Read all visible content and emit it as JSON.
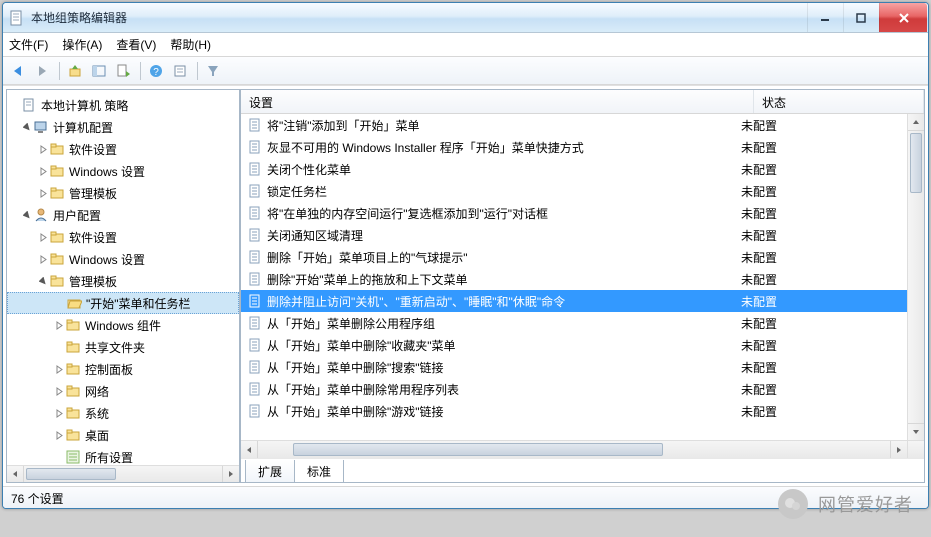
{
  "window": {
    "title": "本地组策略编辑器"
  },
  "menu": {
    "file": "文件(F)",
    "action": "操作(A)",
    "view": "查看(V)",
    "help": "帮助(H)"
  },
  "tree": {
    "root": "本地计算机 策略",
    "computer": {
      "label": "计算机配置",
      "software": "软件设置",
      "windows": "Windows 设置",
      "templates": "管理模板"
    },
    "user": {
      "label": "用户配置",
      "software": "软件设置",
      "windows": "Windows 设置",
      "templates": {
        "label": "管理模板",
        "startmenu": "\"开始\"菜单和任务栏",
        "wincomp": "Windows 组件",
        "shared": "共享文件夹",
        "ctrl": "控制面板",
        "network": "网络",
        "system": "系统",
        "desktop": "桌面",
        "all": "所有设置"
      }
    }
  },
  "list": {
    "header": {
      "setting": "设置",
      "state": "状态"
    },
    "state_unconfigured": "未配置",
    "items": [
      {
        "name": "将\"注销\"添加到「开始」菜单",
        "state": "未配置"
      },
      {
        "name": "灰显不可用的 Windows Installer 程序「开始」菜单快捷方式",
        "state": "未配置"
      },
      {
        "name": "关闭个性化菜单",
        "state": "未配置"
      },
      {
        "name": "锁定任务栏",
        "state": "未配置"
      },
      {
        "name": "将\"在单独的内存空间运行\"复选框添加到\"运行\"对话框",
        "state": "未配置"
      },
      {
        "name": "关闭通知区域清理",
        "state": "未配置"
      },
      {
        "name": "删除「开始」菜单项目上的\"气球提示\"",
        "state": "未配置"
      },
      {
        "name": "删除\"开始\"菜单上的拖放和上下文菜单",
        "state": "未配置"
      },
      {
        "name": "删除并阻止访问\"关机\"、\"重新启动\"、\"睡眠\"和\"休眠\"命令",
        "state": "未配置",
        "selected": true
      },
      {
        "name": "从「开始」菜单删除公用程序组",
        "state": "未配置"
      },
      {
        "name": "从「开始」菜单中删除\"收藏夹\"菜单",
        "state": "未配置"
      },
      {
        "name": "从「开始」菜单中删除\"搜索\"链接",
        "state": "未配置"
      },
      {
        "name": "从「开始」菜单中删除常用程序列表",
        "state": "未配置"
      },
      {
        "name": "从「开始」菜单中删除\"游戏\"链接",
        "state": "未配置"
      }
    ]
  },
  "tabs": {
    "extended": "扩展",
    "standard": "标准"
  },
  "status": {
    "text": "76 个设置"
  },
  "watermark": {
    "text": "网管爱好者"
  }
}
